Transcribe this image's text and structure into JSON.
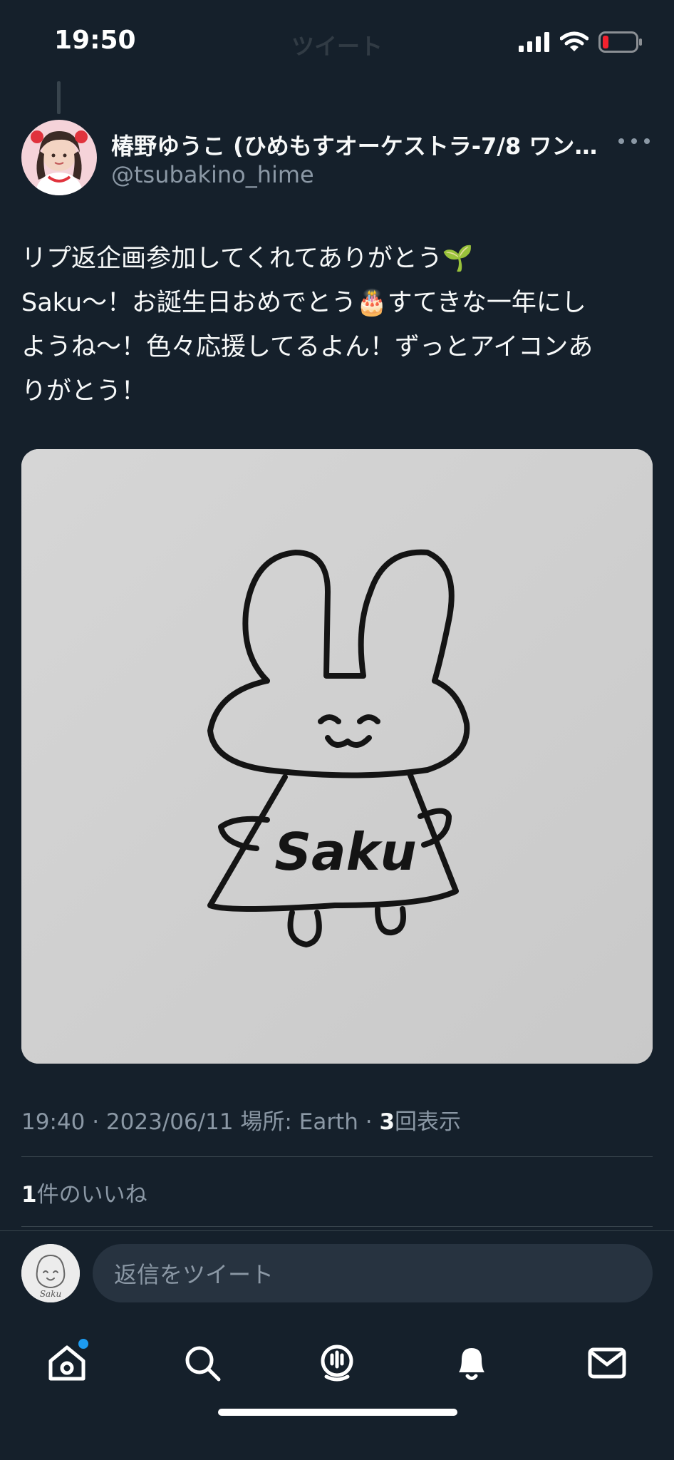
{
  "status_bar": {
    "time": "19:50",
    "faded_title": "ツイート",
    "icons": [
      "signal-icon",
      "wifi-icon",
      "battery-low-icon"
    ]
  },
  "tweet": {
    "author_name": "椿野ゆうこ (ひめもすオーケストラ-7/8 ワン…",
    "author_handle": "@tsubakino_hime",
    "text_lines": [
      "リプ返企画参加してくれてありがとう🌱",
      "Saku〜！お誕生日おめでとう🎂すてきな一年にし",
      "ようね〜！色々応援してるよん！ずっとアイコンあ",
      "りがとう！"
    ],
    "media_caption_text": "Saku",
    "meta": {
      "time_date": "19:40 · 2023/06/11",
      "location": " 場所: Earth · ",
      "views_count": "3",
      "views_label": "回表示"
    },
    "likes": {
      "count": "1",
      "label": "件のいいね"
    }
  },
  "reply": {
    "placeholder": "返信をツイート",
    "avatar_text": "Saku"
  },
  "nav": {
    "items": [
      "home-icon",
      "search-icon",
      "spaces-icon",
      "notifications-icon",
      "messages-icon"
    ]
  },
  "colors": {
    "background": "#15202b",
    "text": "#f7f9f9",
    "secondary": "#8b98a5",
    "accent": "#1d9bf0",
    "battery": "#f4212e"
  }
}
